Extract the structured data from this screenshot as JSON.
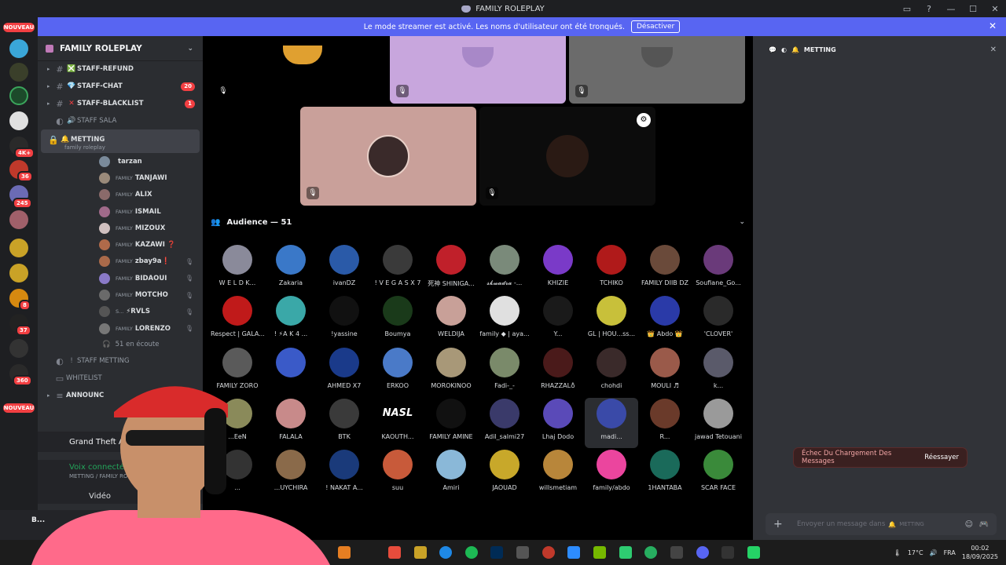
{
  "titlebar": {
    "title": "FAMILY ROLEPLAY"
  },
  "banner": {
    "text": "Le mode streamer est activé. Les noms d'utilisateur ont été tronqués.",
    "button": "Désactiver"
  },
  "rail": {
    "nouveau_top": "NOUVEAU",
    "nouveau_bottom": "NOUVEAU",
    "badges": [
      "4K+",
      "36",
      "245",
      "8",
      "37",
      "360"
    ]
  },
  "server": {
    "name": "FAMILY ROLEPLAY"
  },
  "channels": [
    {
      "name": "STAFF-REFUND",
      "emoji": "❎",
      "count": ""
    },
    {
      "name": "STAFF-CHAT",
      "emoji": "💎",
      "count": "20"
    },
    {
      "name": "STAFF-BLACKLIST",
      "emoji": "✕",
      "count": "1"
    },
    {
      "name": "STAFF SALA",
      "emoji": "🔊",
      "count": ""
    }
  ],
  "active_channel": {
    "name": "METTING",
    "sub": "family roleplay"
  },
  "members": [
    {
      "tag": "",
      "name": "tarzan",
      "muted": false
    },
    {
      "tag": "FAMILY",
      "name": "TANJAWI",
      "muted": false
    },
    {
      "tag": "FAMILY",
      "name": "ALIX",
      "muted": false
    },
    {
      "tag": "FAMILY",
      "name": "ISMAIL",
      "muted": false
    },
    {
      "tag": "FAMILY",
      "name": "MIZOUX",
      "muted": false
    },
    {
      "tag": "FAMILY",
      "name": "KAZAWI ❓",
      "muted": false
    },
    {
      "tag": "FAMILY",
      "name": "zbay9a❗",
      "muted": true
    },
    {
      "tag": "FAMILY",
      "name": "BIDAOUI",
      "muted": true
    },
    {
      "tag": "FAMILY",
      "name": "MOTCHO",
      "muted": true
    },
    {
      "tag": "S...",
      "name": "⚡RVLS",
      "muted": true
    },
    {
      "tag": "FAMILY",
      "name": "LORENZO",
      "muted": true
    }
  ],
  "listening": "51 en écoute",
  "staff_metting": "STAFF METTING",
  "whitelist": "WHITELIST",
  "announce": "ANNOUNC",
  "game": "Grand Theft Auto V",
  "voice": {
    "status": "Voix connectée",
    "sub": "METTING / FAMILY RO"
  },
  "video": "Vidéo",
  "user": {
    "name": "B..."
  },
  "audience": {
    "title": "Audience — 51",
    "members": [
      "W E L D K...",
      "Zakaria",
      "ivanDZ",
      "! V E G A S X 7",
      "死神 SHINIGA...",
      "𝓼𝓴𝔀𝓪𝓭𝓻𝓪 -...",
      "KHIZIE",
      "TCHIKO",
      "FAMILY DIIB DZ",
      "Soufiane_Go...",
      "Respect | GALA...",
      "! ⚡A K 4 ...",
      "!yassine",
      "Boumya",
      "WELDIJA",
      "family ◆ | aya...",
      "Y...",
      "GL | HOU...ss...",
      "👑 Abdo 👑",
      "'CLOVER'",
      "FAMILY ZORO",
      "",
      "AHMED X7",
      "ERKOO",
      "MOROKINOO",
      "Fadi-_-",
      "RHAZZAL♁",
      "chohdi",
      "MOULI ♬",
      "k...",
      "...EeN",
      "FALALA",
      "BTK",
      "KAOUTH...",
      "FAMILY AMINE",
      "Adil_salmi27",
      "Lhaj Dodo",
      "madi...",
      "R...",
      "jawad Tetouani",
      "...",
      "...UYCHIRA",
      "! NAKAT A...",
      "suu",
      "Amiri",
      "JAOUAD",
      "willsmetiam",
      "family/abdo",
      "1HANTABA",
      "SCAR FACE"
    ],
    "nasl_label": "NASL"
  },
  "right_panel": {
    "channel": "METTING",
    "error": "Échec Du Chargement Des Messages",
    "retry": "Réessayer",
    "placeholder": "Envoyer un message dans",
    "placeholder_channel": "METTING"
  },
  "taskbar": {
    "temp": "17°C",
    "lang": "FRA",
    "time": "00:02",
    "date": "18/09/2025"
  },
  "colors": {
    "accent": "#5865f2",
    "danger": "#f23f42",
    "online": "#23a55a"
  }
}
